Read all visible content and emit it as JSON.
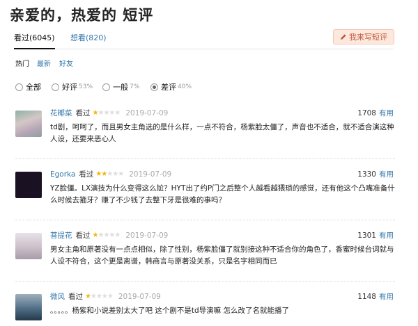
{
  "page": {
    "title": "亲爱的，热爱的 短评"
  },
  "tabs": [
    {
      "label": "看过(6045)"
    },
    {
      "label": "想看(820)"
    }
  ],
  "write_button": {
    "label": "我来写短评",
    "icon": "pencil-icon"
  },
  "sort_options": [
    "热门",
    "最新",
    "好友"
  ],
  "filters": [
    {
      "label": "全部",
      "pct": "",
      "checked": false
    },
    {
      "label": "好评",
      "pct": "53%",
      "checked": false
    },
    {
      "label": "一般",
      "pct": "7%",
      "checked": false
    },
    {
      "label": "差评",
      "pct": "40%",
      "checked": true
    }
  ],
  "reviews": [
    {
      "user": "花椰菜",
      "status": "看过",
      "rating": 1,
      "max_rating": 5,
      "date": "2019-07-09",
      "votes": "1708",
      "useful_label": "有用",
      "content": "td剧，呵呵了，而且男女主角选的是什么样，一点不符合，杨紫脸太僵了，声音也不适合，就不适合演这种人设，还要来恶心人"
    },
    {
      "user": "Egorka",
      "status": "看过",
      "rating": 2,
      "max_rating": 5,
      "date": "2019-07-09",
      "votes": "1330",
      "useful_label": "有用",
      "content": "YZ脸僵。LX演技为什么变得这么尬？HYT出了约P门之后整个人越看越猥琐的感觉，还有他这个凸嘴准备什么时候去箍牙？赚了不少钱了去整下牙是很难的事吗？"
    },
    {
      "user": "菩提花",
      "status": "看过",
      "rating": 1,
      "max_rating": 5,
      "date": "2019-07-09",
      "votes": "1301",
      "useful_label": "有用",
      "content": "男女主角和原著没有一点点相似，除了性别，杨紫脸僵了就别接这种不适合你的角色了，香蜜时候台词就与人设不符合，这个更是离谱，韩商言与原著没关系，只是名字相同而已"
    },
    {
      "user": "微风",
      "status": "看过",
      "rating": 1,
      "max_rating": 5,
      "date": "2019-07-09",
      "votes": "1148",
      "useful_label": "有用",
      "content": "。。。。。杨紫和小说差别太大了吧 这个剧不是td导演嘛 怎么改了名就能播了"
    }
  ],
  "colors": {
    "link": "#3377aa",
    "star": "#f5b60f",
    "button_bg": "#fde8de",
    "button_text": "#c0583a"
  }
}
